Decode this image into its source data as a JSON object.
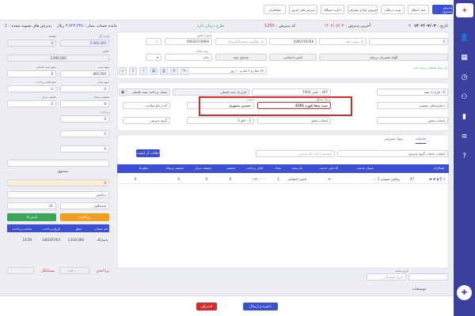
{
  "tabs": [
    "پذیرش صندوق",
    "صف انتظار",
    "نوبت دریافت",
    "فروش لوازم مصرفی",
    "اجاره دستگاه",
    "پذیرش های امروز",
    "مسافران"
  ],
  "header": {
    "date_label": "تاریخ :",
    "date_value": "۱۴۰۲/۰۷/۰۳",
    "patient_type": "طرح درمان دارد",
    "reception_code_label": "کد پذیرش :",
    "reception_code_value": "1250",
    "last_reception_label": "آخرین پذیرش :",
    "last_reception_value": "۱۴۰۲/۰۷/۰۳",
    "balance_label": "مانده حساب بیمار :",
    "balance_value": "۳,۷۴۳,۳۳۸",
    "balance_unit": "ریال",
    "unpaid_label": "پذیرش های تسویه نشده :",
    "unpaid_value": "1"
  },
  "patient": {
    "file_no": "6",
    "national_code_placeholder": "کد پرونده ملی",
    "national_code": "2060740356",
    "electronic_code_placeholder": "کد رهگیری نسخه الکترونیک",
    "ssn_label": "شماره تماس",
    "ssn": "09033150809",
    "name": "الهام مشیریان پرستار",
    "insurance": "تامین اجتماعی",
    "ins_type": "صندوق بیمه",
    "father": "ندارد",
    "age": "۳۳ سال و ۹ ماه و ۱۰ روز",
    "online_msg": "این بیمار استعلام درمان ندارد",
    "doc_label": "بیمه مکمل"
  },
  "form": {
    "reception_type": "6 - قرارداد بیمه",
    "contract": "447 - تامین 1404",
    "supplement": "قرارداد بیمه تکمیلی",
    "supp_pay": "سقف پرداخت بیمه تکمیلی",
    "clinic": "دندانپزشکی عمومی",
    "doctor": "سید صفا کوزه 4281",
    "doctor_label": "پزشک معالج",
    "assistant": "حسین تیموری",
    "assistant_label": "دستیار",
    "ref_code": "کد ارجاع سلامت",
    "room": "1 - اتاق 3",
    "reg_label": "انتخاب بخش",
    "cash_label": "گروه پذیرش",
    "service_tab": "خدمات",
    "drug_tab": "مواد مصرفی"
  },
  "services_toolbar": {
    "group": "انتخاب خدمات گروه پذیرش",
    "search": "جستجو با کد / نام خدمت",
    "select_list": "انتخاب از لیست"
  },
  "table": {
    "headers": [
      "همکاران",
      "",
      "عنوان خدمت",
      "کد ملی خدمت",
      "نام بیمه",
      "تعداد",
      "قابل پرداخت",
      "تخفیف",
      "تخفیف مرکز",
      "تخفیف پزشک",
      "مبلغ ما"
    ],
    "row": {
      "code": "47",
      "title": "روکش عمومی 1 - ...",
      "insurance": "تامین اجتماعی",
      "qty": "1",
      "payable": "۱,۸۹۰,۰۰۰",
      "disc1": "0",
      "disc2": "0",
      "disc3": "0",
      "total": "0"
    }
  },
  "left": {
    "total_label": "قیمت کل",
    "total_value": "2,000,000",
    "discount_label": "تخفیف",
    "discount_value": "0",
    "net_label": "خالص",
    "net_value": "2,000,000",
    "f1_label": "سهم بیمه",
    "f1_value": "800,000",
    "f2_label": "سهم بیمه تکمیلی",
    "f2_value": "0",
    "f3_label": "سهم بیمار",
    "f3_value": "0",
    "f4_label": "مبلغ قابل پرداخت",
    "f4_value": "0",
    "f5_label": "تخفیف پزشک",
    "f5_value": "0",
    "f6_label": "تخفیف مرکز",
    "f6_value": "0",
    "f7_label": "پرداخت",
    "f7_value": "0",
    "fund_title": "صندوق",
    "fund_amount": "0",
    "fund_type": "تراکنش",
    "fund_note": "پاسخگوی",
    "fund_count": "11",
    "pay_btn": "پرداخت",
    "refund_btn": "استرداد",
    "tbl_h": [
      "نام حساب",
      "مبلغ",
      "تاریخ پرداخت",
      "ساعت پرداخت"
    ],
    "tbl_r": [
      "پاسارگاد",
      "1,610,000",
      "1402/07/03",
      "14:59"
    ],
    "remain_label": "پرداختی",
    "remain_value": "۱,۶۱۰,۰۰۰",
    "debt_label": "بستانکار",
    "debt_value": "۰"
  },
  "notes": {
    "history_label": "تاریخ سابقه",
    "history_placeholder": "تاریخ خوابیدگی",
    "desc_label": "توضیحات"
  },
  "bottom": {
    "save_print": "ذخیره و ارسال",
    "cancel": "انصراف"
  },
  "colors": {
    "primary": "#3b4fd0",
    "sidebar": "#3b3f9e",
    "accent_red": "#d42a2a",
    "orange": "#f0a020",
    "green": "#3aa65a"
  }
}
